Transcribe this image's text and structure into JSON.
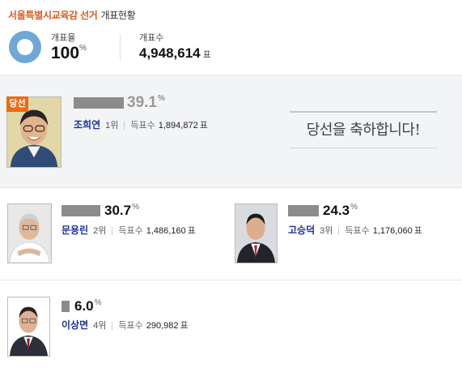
{
  "header": {
    "title_accent": "서울특별시교육감 선거",
    "title_rest": "개표현황",
    "count_rate_label": "개표율",
    "count_rate_value": "100",
    "count_rate_unit": "%",
    "count_label": "개표수",
    "count_value": "4,948,614",
    "count_unit": "표"
  },
  "winner": {
    "badge": "당선",
    "name": "조희연",
    "rank": "1위",
    "votes_label": "득표수",
    "votes": "1,894,872",
    "votes_unit": "표",
    "percent": "39.1",
    "percent_unit": "%",
    "congrats": "당선을 축하합니다!"
  },
  "candidates": [
    {
      "name": "문용린",
      "rank": "2위",
      "votes_label": "득표수",
      "votes": "1,486,160",
      "votes_unit": "표",
      "percent": "30.7",
      "percent_unit": "%"
    },
    {
      "name": "고승덕",
      "rank": "3위",
      "votes_label": "득표수",
      "votes": "1,176,060",
      "votes_unit": "표",
      "percent": "24.3",
      "percent_unit": "%"
    },
    {
      "name": "이상면",
      "rank": "4위",
      "votes_label": "득표수",
      "votes": "290,982",
      "votes_unit": "표",
      "percent": "6.0",
      "percent_unit": "%"
    }
  ],
  "colors": {
    "accent": "#e05a1c",
    "badge": "#ee6a10",
    "name": "#1b2fa0",
    "bar": "#8c8c8c",
    "donut": "#6fa7d8"
  }
}
